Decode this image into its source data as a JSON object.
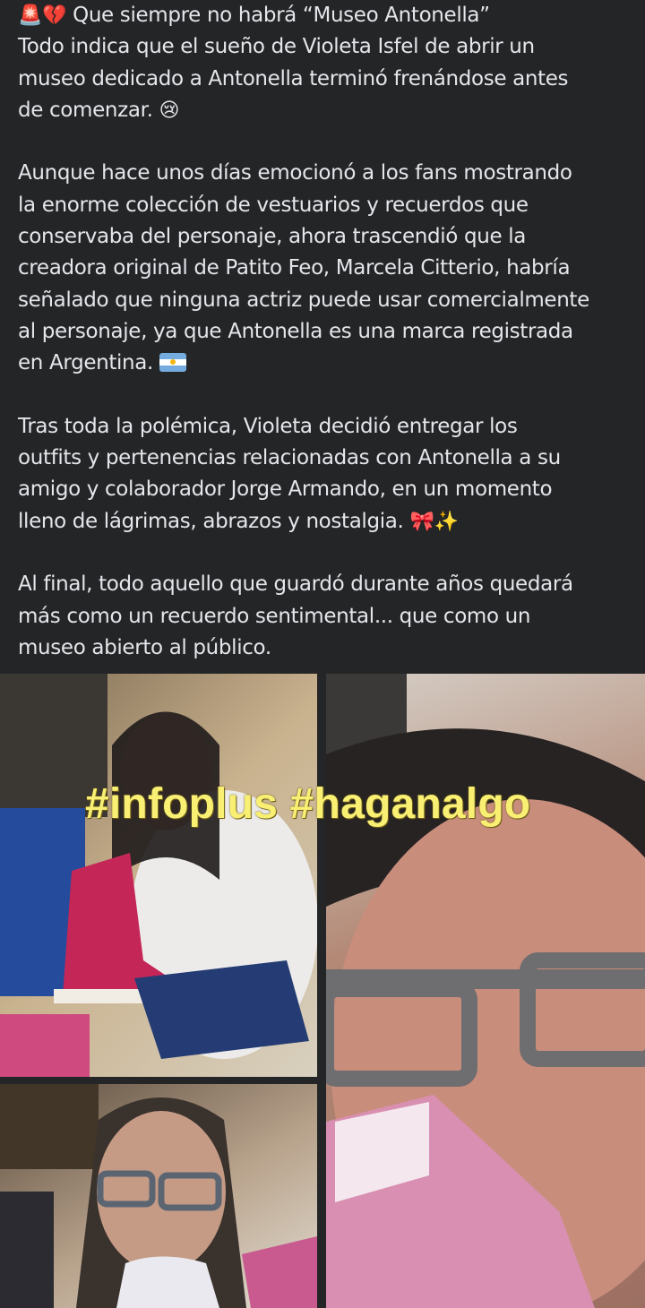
{
  "post": {
    "line1_emoji": "🚨💔",
    "line1_text": "Que siempre no habrá “Museo Antonella”",
    "line2": "Todo indica que el sueño de Violeta Isfel de abrir un",
    "line3": "museo dedicado a Antonella terminó frenándose antes",
    "line4_text": "de comenzar.",
    "line4_emoji": "😢",
    "line5": "Aunque hace unos días emocionó a los fans mostrando",
    "line6": "la enorme colección de vestuarios y recuerdos que",
    "line7": "conservaba del personaje, ahora trascendió que la",
    "line8": "creadora original de Patito Feo, Marcela Citterio, habría",
    "line9": "señalado que ninguna actriz puede usar comercialmente",
    "line10": "al personaje, ya que Antonella es una marca registrada",
    "line11_text": "en Argentina.",
    "line12": "Tras toda la polémica, Violeta decidió entregar los",
    "line13": "outfits y pertenencias relacionadas con Antonella a su",
    "line14": "amigo y colaborador Jorge Armando, en un momento",
    "line15_text": "lleno de lágrimas, abrazos y nostalgia.",
    "line15_emoji": "🎀✨",
    "line16": "Al final, todo aquello que guardó durante años quedará",
    "line17": "más como un recuerdo sentimental... que como un",
    "line18": "museo abierto al público."
  },
  "overlay_text": "#infoplus #haganalgo"
}
